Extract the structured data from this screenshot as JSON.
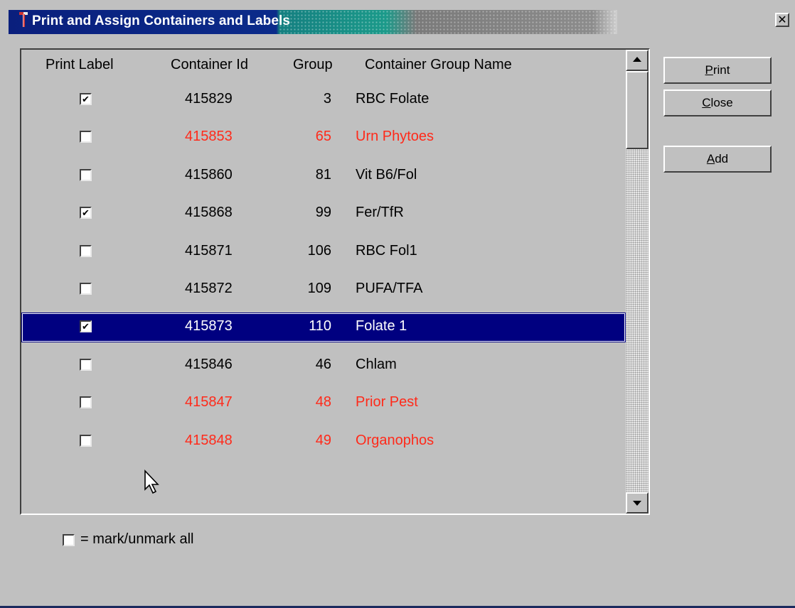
{
  "window": {
    "title": "Print and Assign Containers and Labels",
    "close_glyph": "✕"
  },
  "grid": {
    "columns": [
      "Print Label",
      "Container Id",
      "Group",
      "Container Group Name"
    ],
    "rows": [
      {
        "checked": true,
        "container_id": "415829",
        "group": "3",
        "name": "RBC Folate",
        "highlight": "none"
      },
      {
        "checked": false,
        "container_id": "415853",
        "group": "65",
        "name": "Urn Phytoes",
        "highlight": "red"
      },
      {
        "checked": false,
        "container_id": "415860",
        "group": "81",
        "name": "Vit B6/Fol",
        "highlight": "none"
      },
      {
        "checked": true,
        "container_id": "415868",
        "group": "99",
        "name": "Fer/TfR",
        "highlight": "none"
      },
      {
        "checked": false,
        "container_id": "415871",
        "group": "106",
        "name": "RBC Fol1",
        "highlight": "none"
      },
      {
        "checked": false,
        "container_id": "415872",
        "group": "109",
        "name": "PUFA/TFA",
        "highlight": "none"
      },
      {
        "checked": true,
        "container_id": "415873",
        "group": "110",
        "name": "Folate 1",
        "highlight": "selected"
      },
      {
        "checked": false,
        "container_id": "415846",
        "group": "46",
        "name": "Chlam",
        "highlight": "none"
      },
      {
        "checked": false,
        "container_id": "415847",
        "group": "48",
        "name": "Prior Pest",
        "highlight": "red"
      },
      {
        "checked": false,
        "container_id": "415848",
        "group": "49",
        "name": "Organophos",
        "highlight": "red"
      }
    ]
  },
  "buttons": {
    "print": {
      "accel": "P",
      "rest": "rint"
    },
    "close": {
      "accel": "C",
      "rest": "lose"
    },
    "add": {
      "accel": "A",
      "rest": "dd"
    }
  },
  "mark_all": {
    "label": "= mark/unmark all",
    "checked": false
  },
  "colors": {
    "titlebar": "#0a1f7d",
    "selected_row": "#000080",
    "alert_text": "#ff2a1a",
    "face": "#c0c0c0"
  }
}
